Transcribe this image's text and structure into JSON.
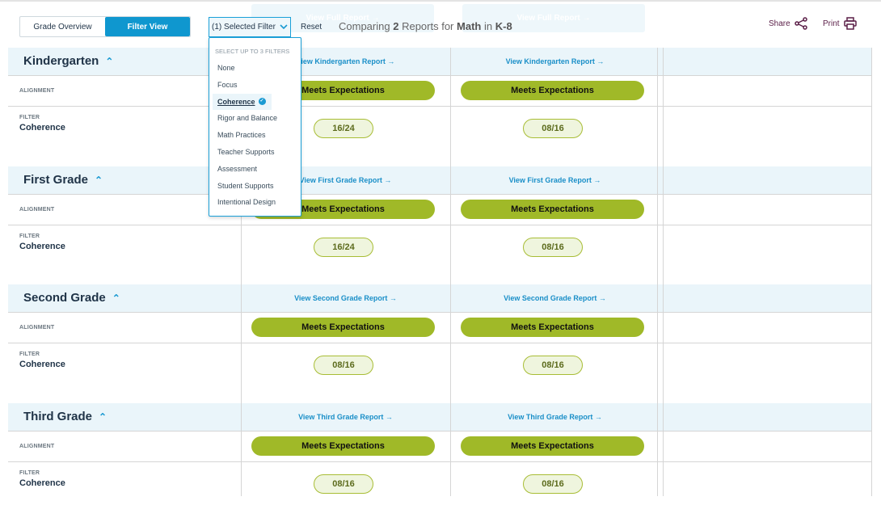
{
  "toolbar": {
    "tabs": [
      {
        "label": "Grade Overview",
        "active": false
      },
      {
        "label": "Filter View",
        "active": true
      }
    ],
    "filter_button": "(1) Selected Filter",
    "reset": "Reset",
    "compare_prefix": "Comparing",
    "compare_count": "2",
    "compare_mid": "Reports for",
    "compare_subject": "Math",
    "compare_in": "in",
    "compare_grades": "K-8",
    "ghost_link": "View Full Report →",
    "share": "Share",
    "print": "Print"
  },
  "dropdown": {
    "heading": "SELECT UP TO 3 FILTERS",
    "items": [
      "None",
      "Focus",
      "Coherence",
      "Rigor and Balance",
      "Math Practices",
      "Teacher Supports",
      "Assessment",
      "Student Supports",
      "Intentional Design"
    ],
    "selected": "Coherence"
  },
  "labels": {
    "alignment": "ALIGNMENT",
    "filter": "FILTER",
    "filter_value": "Coherence"
  },
  "colors": {
    "accent": "#0f97cf",
    "meets": "#a0b928",
    "share": "#5a1e47"
  },
  "sections": [
    {
      "title": "Kindergarten",
      "link": "View Kindergarten Report →",
      "alignment": [
        "Meets Expectations",
        "Meets Expectations"
      ],
      "scores": [
        "16/24",
        "08/16"
      ]
    },
    {
      "title": "First Grade",
      "link": "View First Grade Report →",
      "alignment": [
        "Meets Expectations",
        "Meets Expectations"
      ],
      "scores": [
        "16/24",
        "08/16"
      ]
    },
    {
      "title": "Second Grade",
      "link": "View Second Grade Report →",
      "alignment": [
        "Meets Expectations",
        "Meets Expectations"
      ],
      "scores": [
        "08/16",
        "08/16"
      ]
    },
    {
      "title": "Third Grade",
      "link": "View Third Grade Report →",
      "alignment": [
        "Meets Expectations",
        "Meets Expectations"
      ],
      "scores": [
        "08/16",
        "08/16"
      ]
    }
  ]
}
